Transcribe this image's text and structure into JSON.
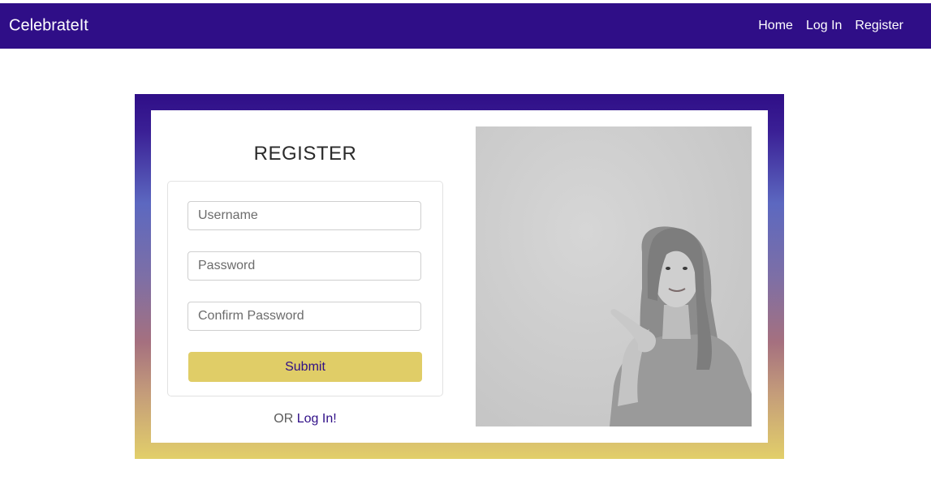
{
  "navbar": {
    "brand": "CelebrateIt",
    "links": [
      "Home",
      "Log In",
      "Register"
    ]
  },
  "register": {
    "title": "REGISTER",
    "username_placeholder": "Username",
    "password_placeholder": "Password",
    "confirm_placeholder": "Confirm Password",
    "submit_label": "Submit",
    "or_text": "OR",
    "login_link": "Log In!"
  },
  "colors": {
    "primary": "#2f0e87",
    "accent": "#e0cd67"
  },
  "image": {
    "icon": "woman-pointing-photo"
  }
}
